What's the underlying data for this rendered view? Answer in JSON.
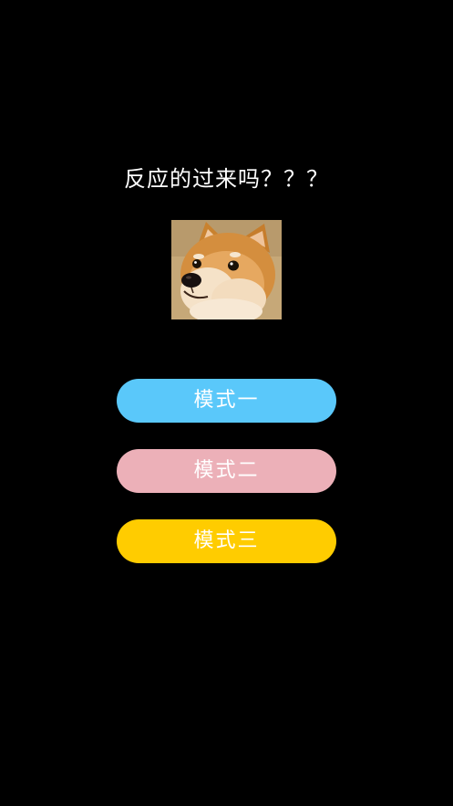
{
  "title": "反应的过来吗？？？",
  "image": {
    "icon": "doge-image"
  },
  "modes": [
    {
      "label": "模式一",
      "color": "#5ac8fa"
    },
    {
      "label": "模式二",
      "color": "#ecb0b8"
    },
    {
      "label": "模式三",
      "color": "#ffcc00"
    }
  ]
}
